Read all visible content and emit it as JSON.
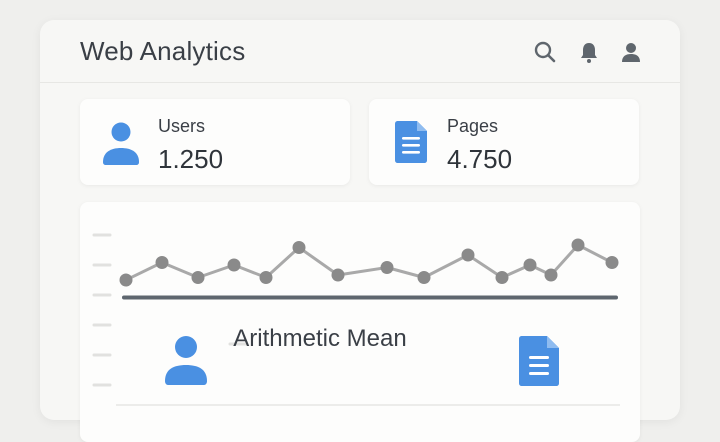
{
  "header": {
    "title": "Web Analytics",
    "icons": [
      "search-icon",
      "bell-icon",
      "user-icon"
    ]
  },
  "stats": [
    {
      "label": "Users",
      "value": "1.250",
      "icon": "user-icon",
      "color": "#4a90e2"
    },
    {
      "label": "Pages",
      "value": "4.750",
      "icon": "document-icon",
      "color": "#4a90e2"
    }
  ],
  "chart": {
    "mean_label": "Arithmetic Mean",
    "icons": [
      "user-icon",
      "document-icon"
    ]
  },
  "chart_data": {
    "type": "line",
    "y": [
      36,
      43,
      37,
      42,
      37,
      49,
      38,
      41,
      37,
      46,
      37,
      42,
      38,
      50,
      43
    ],
    "mean": 29,
    "ylim": [
      0,
      60
    ],
    "line_color": "#a9a9a9",
    "point_color": "#8a8a8a",
    "mean_color": "#5e666e",
    "grid": false
  }
}
